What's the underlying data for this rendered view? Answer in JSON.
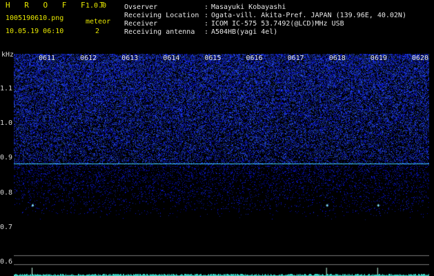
{
  "header": {
    "app_name": "H R O F F T",
    "version": "1.0.0",
    "filename": "1005190610.png",
    "datetime": "10.05.19 06:10",
    "meteor_label": "meteor",
    "meteor_count": "2",
    "info": [
      {
        "label": "Ovserver",
        "value": "Masayuki Kobayashi"
      },
      {
        "label": "Receiving Location",
        "value": "Ogata-vill. Akita-Pref. JAPAN (139.96E, 40.02N)"
      },
      {
        "label": "Receiver",
        "value": "ICOM IC-575 53.7492(@LCD)MHz USB"
      },
      {
        "label": "Receiving antenna",
        "value": "A504HB(yagi 4el)"
      }
    ],
    "separator": ":"
  },
  "colors": {
    "header_yellow": "#e8e800",
    "noise_blue": "#2a3fd0",
    "baseline_cyan": "#40d0ff",
    "background": "#000000"
  },
  "chart_data": {
    "type": "heatmap",
    "ylabel": "kHz",
    "y_ticks": [
      "1.1",
      "1.0",
      "0.9",
      "0.8",
      "0.7",
      "0.6"
    ],
    "x_ticks": [
      "0611",
      "0612",
      "0613",
      "0614",
      "0615",
      "0616",
      "0617",
      "0618",
      "0619",
      "0620"
    ],
    "carrier_line_khz": 0.885,
    "meteor_echoes": [
      {
        "time": "0611",
        "khz": 0.76
      },
      {
        "time": "0618",
        "khz": 0.76
      },
      {
        "time": "0619",
        "khz": 0.76
      }
    ]
  }
}
